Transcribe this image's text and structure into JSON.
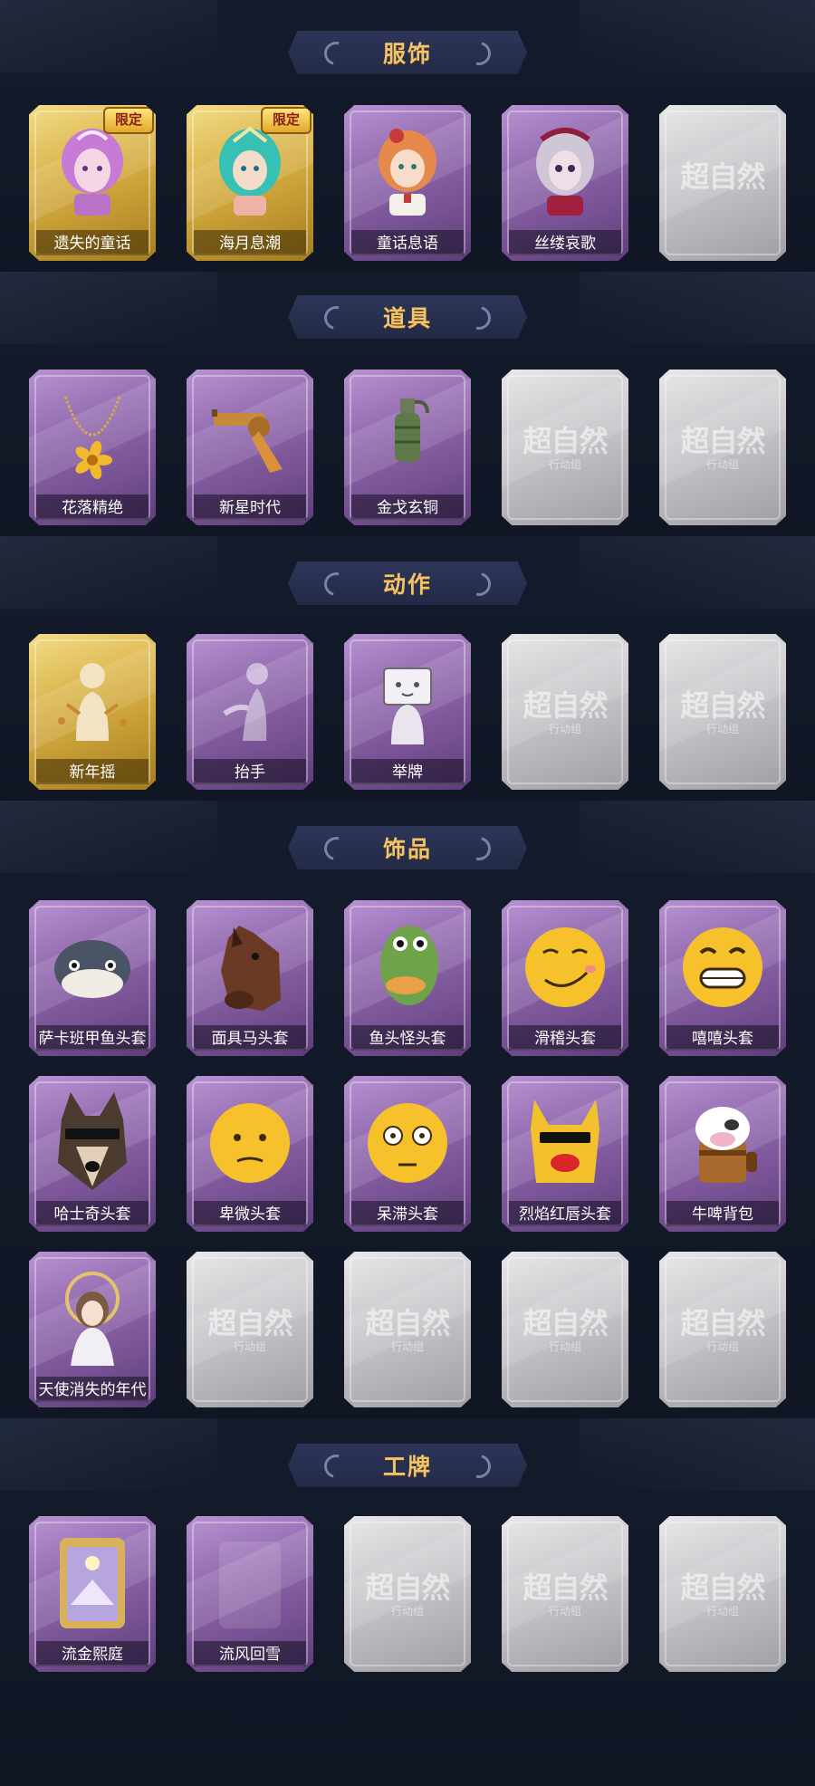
{
  "sections": [
    {
      "title": "服饰",
      "cards": [
        {
          "label": "遗失的童话",
          "tier": "gold",
          "tag": "限定",
          "icon": "princess-portrait"
        },
        {
          "label": "海月息潮",
          "tier": "gold",
          "tag": "限定",
          "icon": "mermaid-portrait"
        },
        {
          "label": "童话息语",
          "tier": "purple",
          "icon": "redhead-girl-portrait"
        },
        {
          "label": "丝缕哀歌",
          "tier": "purple",
          "icon": "pale-girl-portrait"
        },
        {
          "label": "",
          "tier": "empty",
          "logo": "超自然"
        }
      ]
    },
    {
      "title": "道具",
      "cards": [
        {
          "label": "花落精绝",
          "tier": "purple",
          "icon": "flower-chain-icon"
        },
        {
          "label": "新星时代",
          "tier": "purple",
          "icon": "revolver-icon"
        },
        {
          "label": "金戈玄铜",
          "tier": "purple",
          "icon": "grenade-icon"
        },
        {
          "label": "",
          "tier": "empty",
          "logo": "超自然",
          "logo_sub": "行动组"
        },
        {
          "label": "",
          "tier": "empty",
          "logo": "超自然",
          "logo_sub": "行动组"
        }
      ]
    },
    {
      "title": "动作",
      "cards": [
        {
          "label": "新年摇",
          "tier": "gold",
          "icon": "dance-silhouette-icon"
        },
        {
          "label": "抬手",
          "tier": "purple",
          "icon": "raise-hand-icon"
        },
        {
          "label": "举牌",
          "tier": "purple",
          "icon": "hold-sign-icon"
        },
        {
          "label": "",
          "tier": "empty",
          "logo": "超自然",
          "logo_sub": "行动组"
        },
        {
          "label": "",
          "tier": "empty",
          "logo": "超自然",
          "logo_sub": "行动组"
        }
      ]
    },
    {
      "title": "饰品",
      "cards": [
        {
          "label": "萨卡班甲鱼头套",
          "tier": "purple",
          "icon": "fish-head-icon"
        },
        {
          "label": "面具马头套",
          "tier": "purple",
          "icon": "horse-mask-icon"
        },
        {
          "label": "鱼头怪头套",
          "tier": "purple",
          "icon": "green-fish-monster-icon"
        },
        {
          "label": "滑稽头套",
          "tier": "purple",
          "icon": "smirk-emoji-icon"
        },
        {
          "label": "嘻嘻头套",
          "tier": "purple",
          "icon": "grin-emoji-icon"
        },
        {
          "label": "哈士奇头套",
          "tier": "purple",
          "icon": "husky-head-icon"
        },
        {
          "label": "卑微头套",
          "tier": "purple",
          "icon": "sad-emoji-icon"
        },
        {
          "label": "呆滞头套",
          "tier": "purple",
          "icon": "blank-stare-emoji-icon"
        },
        {
          "label": "烈焰红唇头套",
          "tier": "purple",
          "icon": "yellow-mask-red-lips-icon"
        },
        {
          "label": "牛啤背包",
          "tier": "purple",
          "icon": "cow-beer-backpack-icon"
        },
        {
          "label": "天使消失的年代",
          "tier": "purple",
          "icon": "angel-doll-icon"
        },
        {
          "label": "",
          "tier": "empty",
          "logo": "超自然",
          "logo_sub": "行动组"
        },
        {
          "label": "",
          "tier": "empty",
          "logo": "超自然",
          "logo_sub": "行动组"
        },
        {
          "label": "",
          "tier": "empty",
          "logo": "超自然",
          "logo_sub": "行动组"
        },
        {
          "label": "",
          "tier": "empty",
          "logo": "超自然",
          "logo_sub": "行动组"
        }
      ]
    },
    {
      "title": "工牌",
      "cards": [
        {
          "label": "流金熙庭",
          "tier": "purple",
          "icon": "golden-frame-badge-icon"
        },
        {
          "label": "流风回雪",
          "tier": "purple",
          "icon": "blank-badge-icon"
        },
        {
          "label": "",
          "tier": "empty",
          "logo": "超自然",
          "logo_sub": "行动组"
        },
        {
          "label": "",
          "tier": "empty",
          "logo": "超自然",
          "logo_sub": "行动组"
        },
        {
          "label": "",
          "tier": "empty",
          "logo": "超自然",
          "logo_sub": "行动组"
        }
      ]
    }
  ]
}
